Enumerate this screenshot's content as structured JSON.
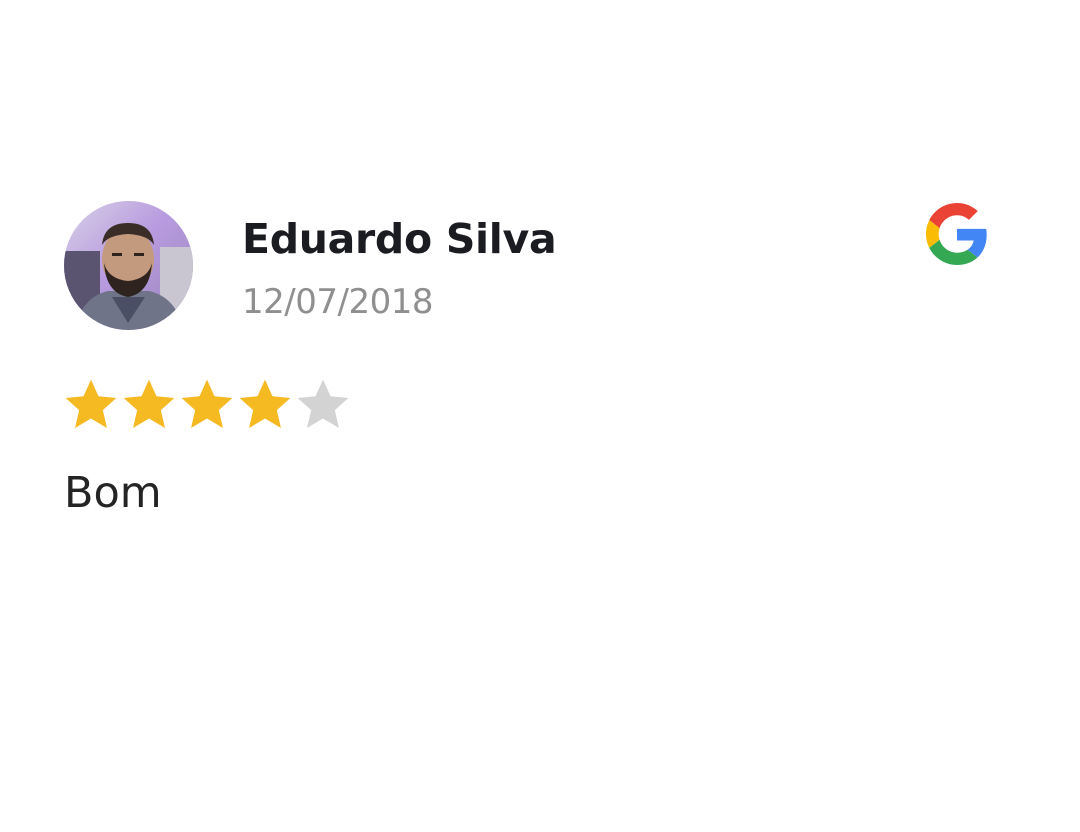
{
  "review": {
    "author_name": "Eduardo Silva",
    "date": "12/07/2018",
    "rating": 4,
    "rating_max": 5,
    "text": "Bom",
    "source_icon": "google-icon",
    "avatar_icon": "avatar"
  },
  "colors": {
    "star_filled": "#F5B921",
    "star_empty": "#D3D3D3",
    "google_blue": "#4285F4",
    "google_red": "#EA4335",
    "google_yellow": "#FBBC05",
    "google_green": "#34A853"
  }
}
